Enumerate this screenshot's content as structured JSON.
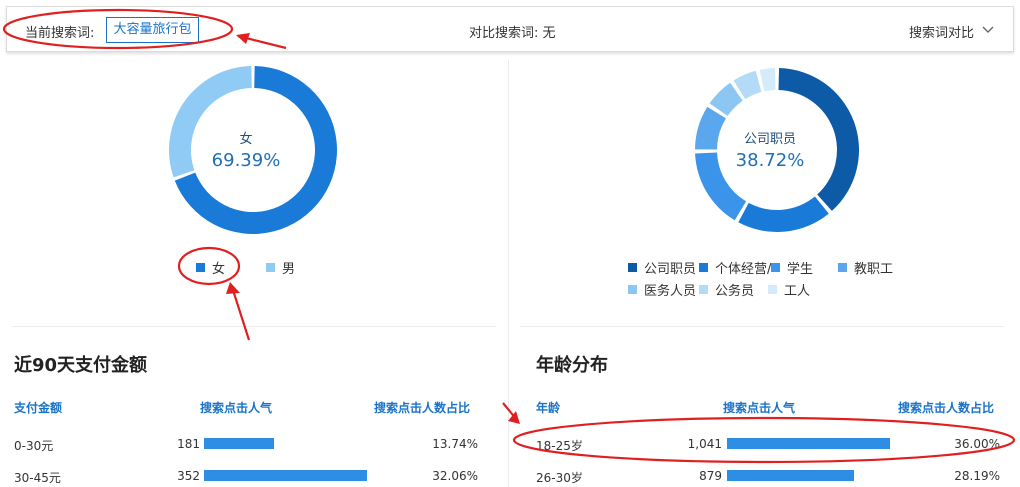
{
  "topbar": {
    "current_label": "当前搜索词:",
    "keyword": "大容量旅行包",
    "compare_text": "对比搜索词: 无",
    "compare_button": "搜索词对比"
  },
  "gender": {
    "center_name": "女",
    "center_value": "69.39%",
    "legend": [
      {
        "label": "女",
        "color": "#1a7ad8"
      },
      {
        "label": "男",
        "color": "#90cbf5"
      }
    ]
  },
  "occupation": {
    "center_name": "公司职员",
    "center_value": "38.72%",
    "legend": [
      {
        "label": "公司职员",
        "color": "#0d5aa7"
      },
      {
        "label": "个体经营/",
        "color": "#1a7ad8"
      },
      {
        "label": "学生",
        "color": "#3c93ea"
      },
      {
        "label": "教职工",
        "color": "#5aa7ee"
      },
      {
        "label": "医务人员",
        "color": "#8cc6f2"
      },
      {
        "label": "公务员",
        "color": "#b3dbf7"
      },
      {
        "label": "工人",
        "color": "#d3ebfb"
      }
    ]
  },
  "chart_data": [
    {
      "type": "pie",
      "center_label": "女",
      "categories": [
        "女",
        "男"
      ],
      "values": [
        69.39,
        30.61
      ]
    },
    {
      "type": "pie",
      "center_label": "公司职员",
      "categories": [
        "公司职员",
        "个体经营/",
        "学生",
        "教职工",
        "医务人员",
        "公务员",
        "工人"
      ],
      "values": [
        38.72,
        19.5,
        16.5,
        9.5,
        6.5,
        5.5,
        3.78
      ]
    }
  ],
  "payment": {
    "title": "近90天支付金额",
    "headers": [
      "支付金额",
      "搜索点击人气",
      "搜索点击人数占比"
    ],
    "rows": [
      {
        "range": "0-30元",
        "popularity": "181",
        "ratio": "13.74%",
        "bar_fraction": 0.43
      },
      {
        "range": "30-45元",
        "popularity": "352",
        "ratio": "32.06%",
        "bar_fraction": 1.0
      }
    ]
  },
  "age": {
    "title": "年龄分布",
    "headers": [
      "年龄",
      "搜索点击人气",
      "搜索点击人数占比"
    ],
    "rows": [
      {
        "range": "18-25岁",
        "popularity": "1,041",
        "ratio": "36.00%",
        "bar_fraction": 1.0
      },
      {
        "range": "26-30岁",
        "popularity": "879",
        "ratio": "28.19%",
        "bar_fraction": 0.78
      }
    ]
  },
  "colors": {
    "accent": "#1a73c8",
    "bar": "#2e8de4",
    "annotation": "#e02020"
  }
}
